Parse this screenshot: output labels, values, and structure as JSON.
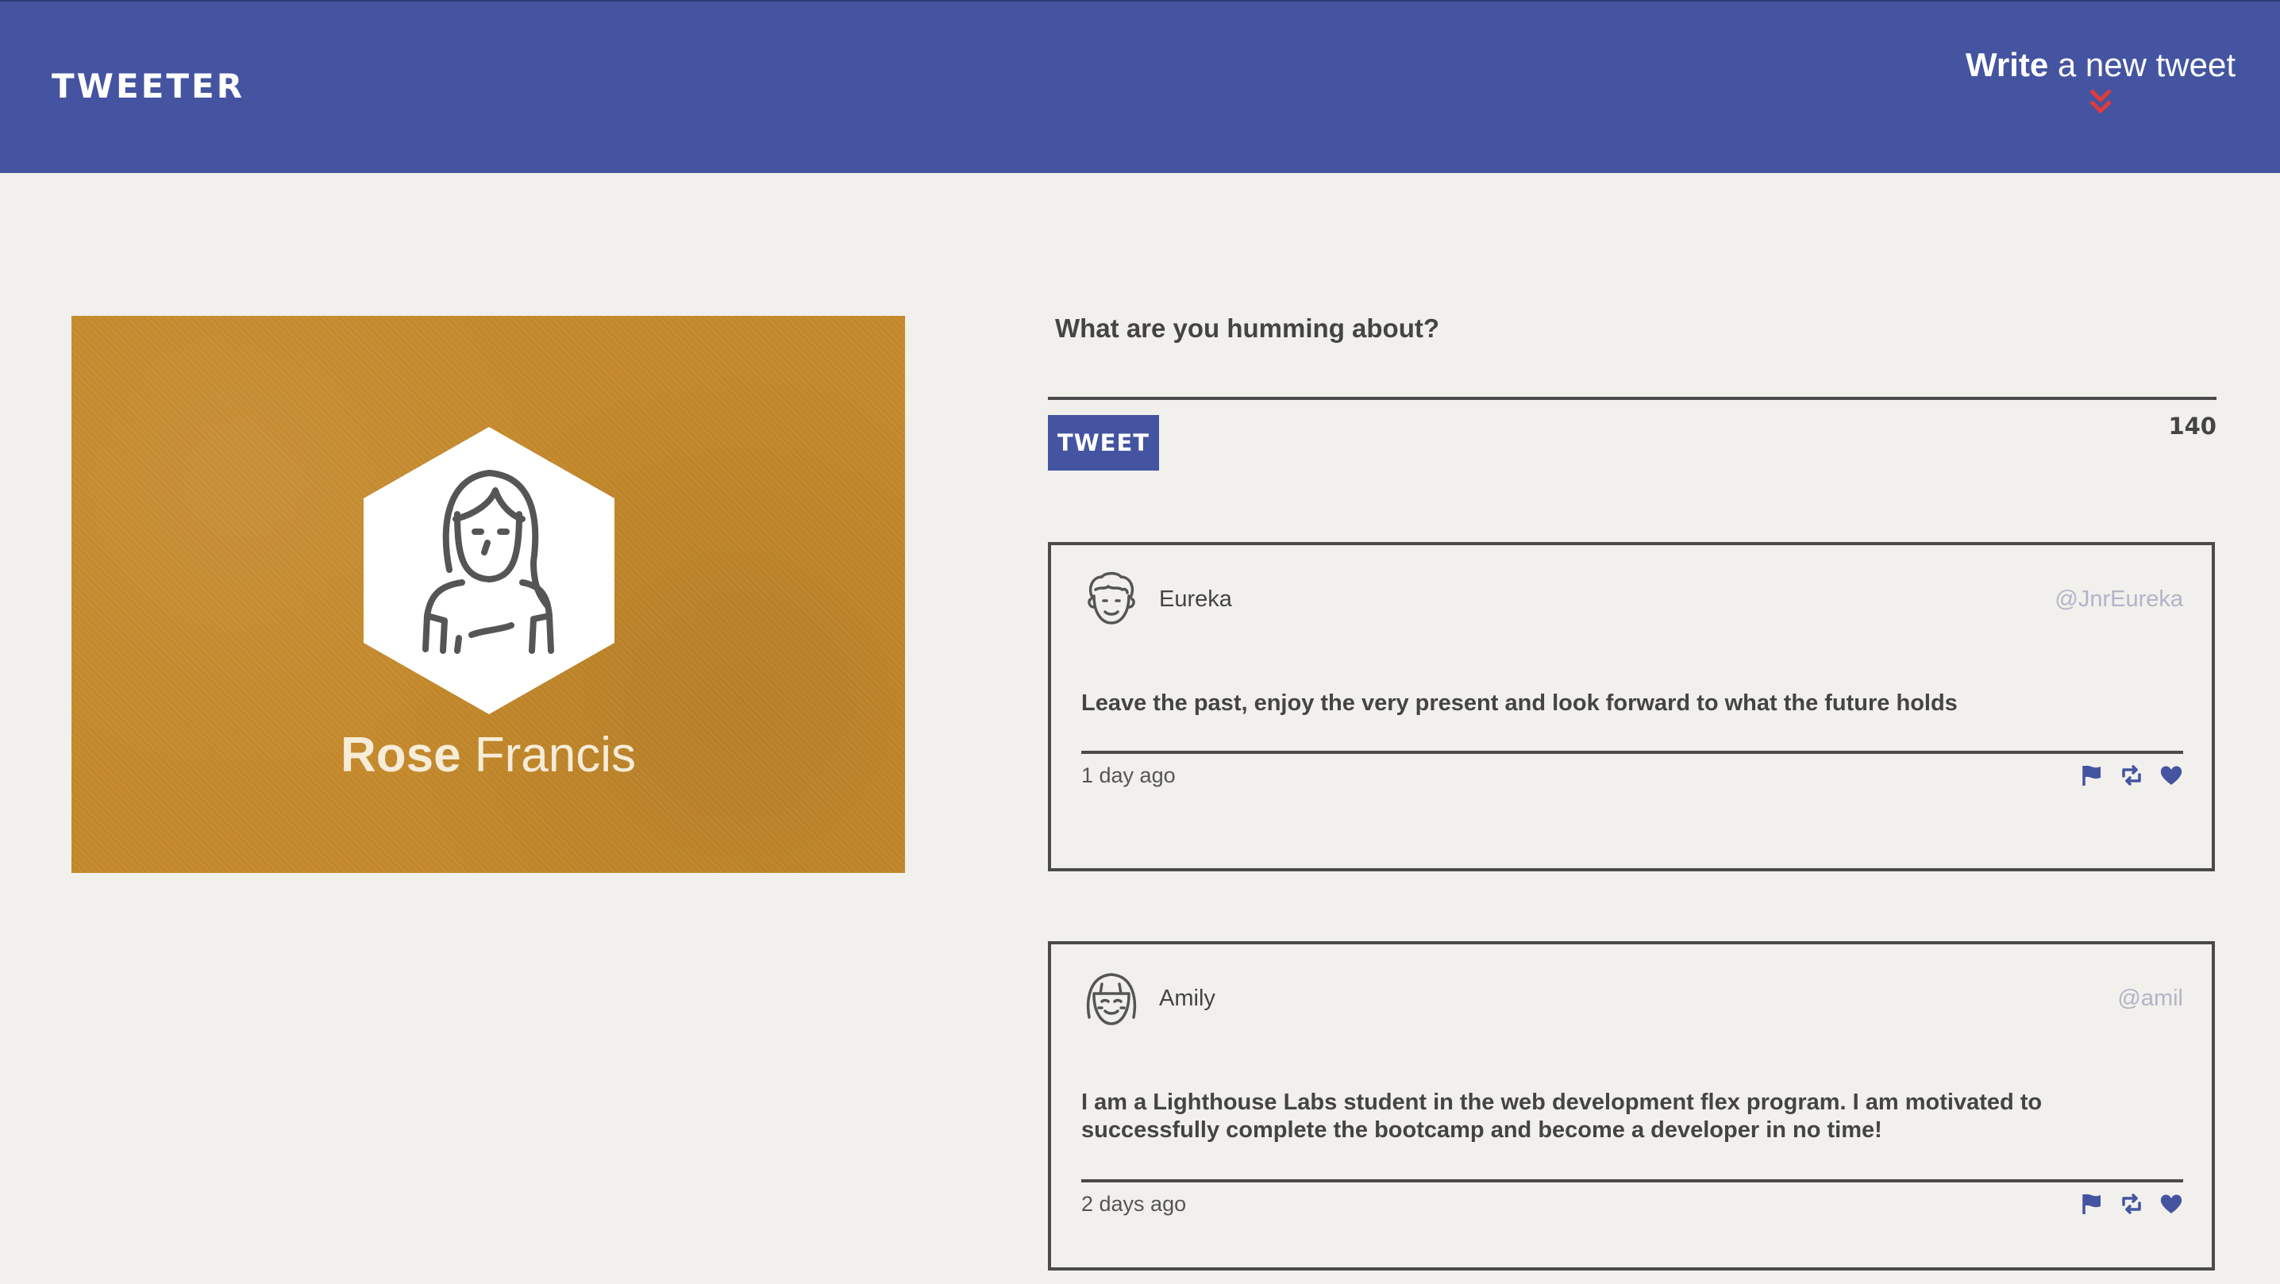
{
  "nav": {
    "logo": "TWEETER",
    "compose_bold": "Write",
    "compose_rest": " a new tweet",
    "compose_arrow_icon": "double-chevron-down-icon",
    "arrow_color": "#e03c3c"
  },
  "profile": {
    "first_name": "Rose",
    "last_name": "Francis",
    "avatar_icon": "woman-avatar-icon"
  },
  "composer": {
    "prompt": "What are you humming about?",
    "button_label": "TWEET",
    "counter": "140"
  },
  "tweets": [
    {
      "name": "Eureka",
      "handle": "@JnrEureka",
      "content": "Leave the past, enjoy the very present and look forward to what the future holds",
      "time": "1 day ago",
      "avatar_icon": "curly-hair-avatar-icon"
    },
    {
      "name": "Amily",
      "handle": "@amil",
      "content": "I am a Lighthouse Labs student in the web development flex program. I am motivated to successfully complete the bootcamp and become a developer in no time!",
      "time": "2 days ago",
      "avatar_icon": "smiling-girl-avatar-icon"
    }
  ],
  "colors": {
    "brand": "#4454a0",
    "background": "#f2f0ec",
    "profile_bg": "#c68a2c",
    "handle": "#b3b3c8"
  }
}
